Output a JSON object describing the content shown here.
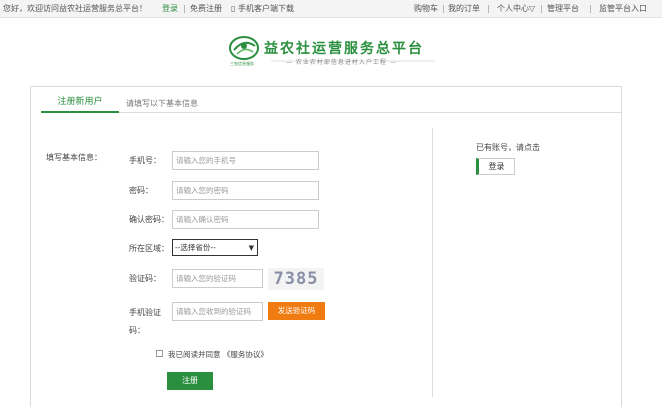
{
  "topbar": {
    "welcome": "您好，欢迎访问益农社运营服务总平台！",
    "login": "登录",
    "separator": "|",
    "register": "免费注册",
    "phone_download": "▯ 手机客户端下载",
    "cart": "购物车",
    "my_orders": "我的订单",
    "user_center": "个人中心▽",
    "manage_platform": "管理平台",
    "supervise_entry": "监管平台入口"
  },
  "logo": {
    "title": "益农社运营服务总平台",
    "subtitle": "— 农业农村部信息进村入户工程 —",
    "small_text": "三农信息服务",
    "accent_color": "#2a8f3f"
  },
  "tabs": {
    "active": "注册新用户",
    "hint": "请填写以下基本信息"
  },
  "form": {
    "section_label": "填写基本信息：",
    "phone_label": "手机号：",
    "phone_placeholder": "请输入您的手机号",
    "password_label": "密码：",
    "password_placeholder": "请输入您的密码",
    "confirm_label": "确认密码：",
    "confirm_placeholder": "请输入确认密码",
    "region_label": "所在区域：",
    "region_selected": "--选择省份--",
    "captcha_label": "验证码：",
    "captcha_placeholder": "请输入您的验证码",
    "captcha_value": "7385",
    "sms_label_line1": "手机验证",
    "sms_label_line2": "码：",
    "sms_placeholder": "请输入您收到的验证码",
    "send_code_button": "发送验证码",
    "agree_text": "我已阅读并同意 《服务协议》",
    "agree_checked": false,
    "register_button": "注册"
  },
  "side": {
    "has_account": "已有账号，请点击",
    "login_button": "登录"
  }
}
